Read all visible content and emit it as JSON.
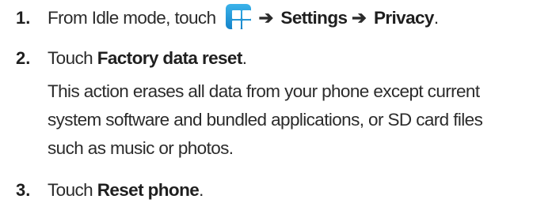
{
  "steps": [
    {
      "number": "1.",
      "text_before_icon": "From Idle mode, touch",
      "icon": "applications-grid-icon",
      "arrow": "➔",
      "menu_path": [
        "Settings",
        "Privacy"
      ],
      "period": "."
    },
    {
      "number": "2.",
      "prefix": "Touch ",
      "bold": "Factory data reset",
      "suffix": ".",
      "description_lines": [
        "This action erases all data from your phone except current",
        "system software and bundled applications, or SD card files",
        "such as music or photos."
      ]
    },
    {
      "number": "3.",
      "prefix": "Touch ",
      "bold": "Reset phone",
      "suffix": "."
    }
  ],
  "colors": {
    "icon_top": "#3bb3ea",
    "icon_bottom": "#1483c9",
    "text": "#2b2b2b"
  }
}
